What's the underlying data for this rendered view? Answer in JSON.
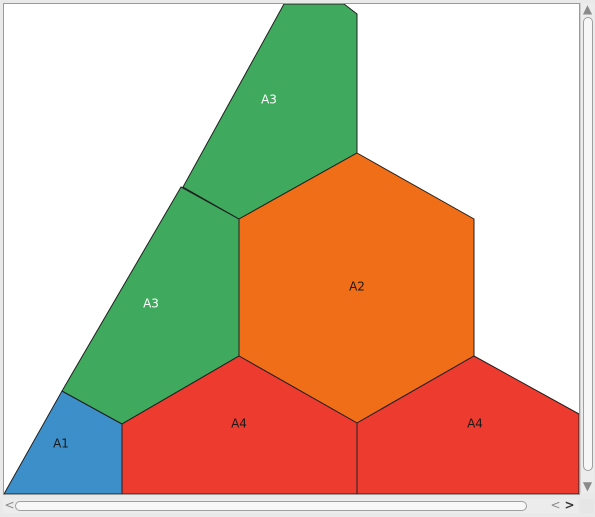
{
  "regions": [
    {
      "id": "a1",
      "label": "A1",
      "fill": "#3d8fca",
      "text_color": "#1a1a1a"
    },
    {
      "id": "a3-top",
      "label": "A3",
      "fill": "#3faa5e",
      "text_color": "#ffffff"
    },
    {
      "id": "a3-mid",
      "label": "A3",
      "fill": "#3faa5e",
      "text_color": "#ffffff"
    },
    {
      "id": "a2",
      "label": "A2",
      "fill": "#f06e17",
      "text_color": "#1a1a1a"
    },
    {
      "id": "a4-left",
      "label": "A4",
      "fill": "#ee3b2f",
      "text_color": "#1a1a1a"
    },
    {
      "id": "a4-right",
      "label": "A4",
      "fill": "#ee3b2f",
      "text_color": "#1a1a1a"
    }
  ],
  "scrollbars": {
    "up_icon": "▲",
    "down_icon": "▼",
    "left_icon": "<",
    "right_icon_faded": "<",
    "right_icon": ">"
  }
}
